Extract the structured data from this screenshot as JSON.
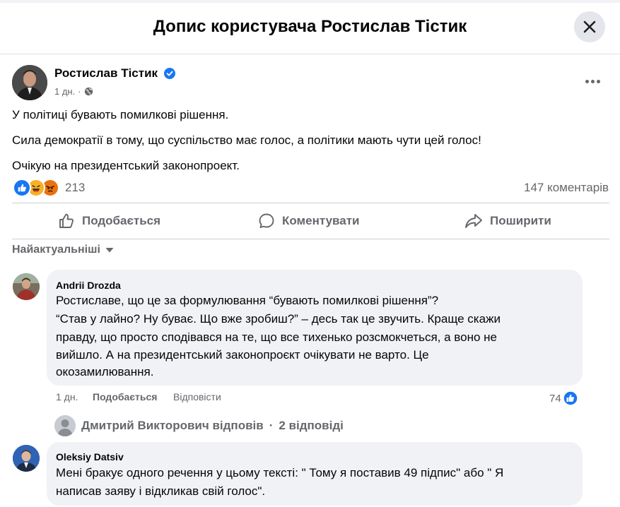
{
  "dialog": {
    "title": "Допис користувача Ростислав Тістик",
    "close_icon": "close-icon"
  },
  "post": {
    "author": "Ростислав Тістик",
    "verified_icon": "verified-badge-icon",
    "time": "1 дн.",
    "separator": "·",
    "audience_icon": "globe-icon",
    "lines": [
      "У політиці бувають помилкові рішення.",
      "Сила демократії в тому, що суспільство має голос, а політики мають чути цей голос!",
      "Очікую на президентський законопроект."
    ],
    "reaction_icons": [
      "like-icon",
      "haha-icon",
      "angry-icon"
    ],
    "reaction_count": "213",
    "comments_count": "147 коментарів"
  },
  "actions": {
    "like": "Подобається",
    "comment": "Коментувати",
    "share": "Поширити"
  },
  "sort_label": "Найактуальніші",
  "comments": [
    {
      "author": "Andrii Drozda",
      "lines": [
        "Ростиславе, що це за формулювання “бувають помилкові рішення”?",
        "“Став у лайно? Ну буває. Що вже зробиш?” – десь так це звучить. Краще скажи",
        "правду, що просто сподівався на те, що все тихенько розсмокчеться, а воно не",
        "вийшло. А на президентський законопроєкт очікувати не варто. Це",
        "окозамилювання."
      ],
      "time": "1 дн.",
      "like_label": "Подобається",
      "reply_label": "Відповісти",
      "like_count": "74"
    },
    {
      "author": "Oleksiy Datsiv",
      "lines": [
        "Мені бракує одного речення у цьому тексті: \" Тому я поставив 49 підпис\" або \" Я",
        "написав заяву і відкликав свій голос\"."
      ]
    }
  ],
  "replies_summary": {
    "author": "Дмитрий Викторович відповів",
    "separator": "·",
    "count": "2 відповіді"
  },
  "colors": {
    "accent": "#1877f2",
    "muted_text": "#65676b",
    "bubble": "#f0f2f5",
    "angry": "#e9710f",
    "haha": "#f7b125"
  }
}
